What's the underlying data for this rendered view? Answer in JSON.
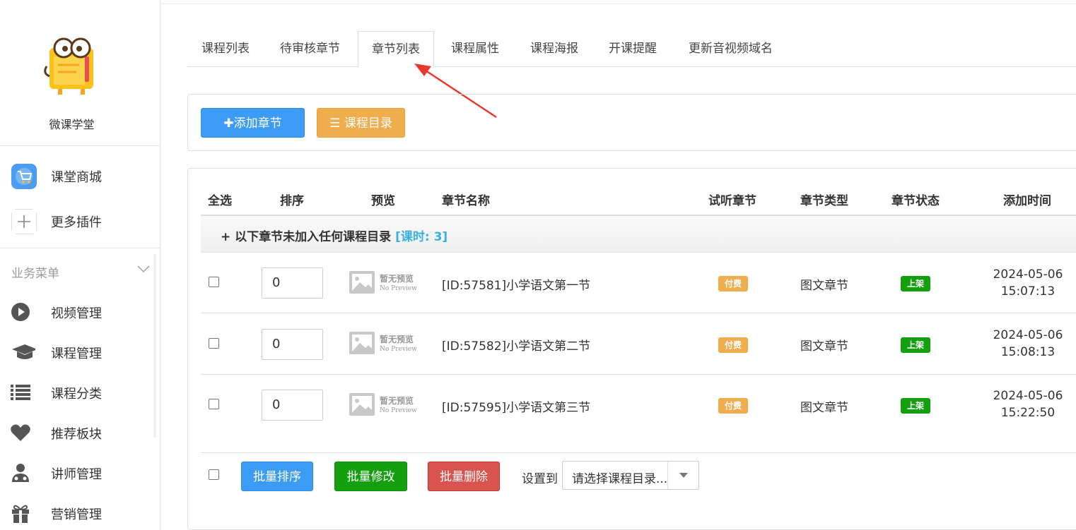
{
  "sidebar": {
    "brand_name": "微课学堂",
    "plugins": [
      {
        "label": "课堂商城",
        "icon": "cart-icon"
      },
      {
        "label": "更多插件",
        "icon": "plus-icon"
      }
    ],
    "menu_header": "业务菜单",
    "menu_items": [
      {
        "label": "视频管理",
        "icon": "play-icon"
      },
      {
        "label": "课程管理",
        "icon": "graduation-cap-icon"
      },
      {
        "label": "课程分类",
        "icon": "list-icon"
      },
      {
        "label": "推荐板块",
        "icon": "heart-icon"
      },
      {
        "label": "讲师管理",
        "icon": "user-md-icon"
      },
      {
        "label": "营销管理",
        "icon": "gift-icon"
      }
    ]
  },
  "tabs": [
    {
      "label": "课程列表",
      "active": false
    },
    {
      "label": "待审核章节",
      "active": false
    },
    {
      "label": "章节列表",
      "active": true
    },
    {
      "label": "课程属性",
      "active": false
    },
    {
      "label": "课程海报",
      "active": false
    },
    {
      "label": "开课提醒",
      "active": false
    },
    {
      "label": "更新音视频域名",
      "active": false
    }
  ],
  "actions": {
    "add_chapter": "添加章节",
    "course_catalog": "课程目录"
  },
  "table": {
    "headers": {
      "select_all": "全选",
      "sort": "排序",
      "preview": "预览",
      "name": "章节名称",
      "trial": "试听章节",
      "type": "章节类型",
      "status": "章节状态",
      "added": "添加时间"
    },
    "group": {
      "prefix": "+ 以下章节未加入任何课程目录",
      "hours": "[课时: 3]"
    },
    "preview_text": {
      "main": "暂无预览",
      "sub": "No Preview"
    },
    "rows": [
      {
        "sort": "0",
        "name": "[ID:57581]小学语文第一节",
        "trial": "付费",
        "type": "图文章节",
        "status": "上架",
        "date": "2024-05-06",
        "time": "15:07:13"
      },
      {
        "sort": "0",
        "name": "[ID:57582]小学语文第二节",
        "trial": "付费",
        "type": "图文章节",
        "status": "上架",
        "date": "2024-05-06",
        "time": "15:08:13"
      },
      {
        "sort": "0",
        "name": "[ID:57595]小学语文第三节",
        "trial": "付费",
        "type": "图文章节",
        "status": "上架",
        "date": "2024-05-06",
        "time": "15:22:50"
      }
    ]
  },
  "bulk": {
    "sort": "批量排序",
    "edit": "批量修改",
    "delete": "批量删除",
    "set_to": "设置到",
    "select_placeholder": "请选择课程目录..."
  },
  "colors": {
    "primary": "#3c9cf5",
    "warning": "#f0ad4e",
    "success": "#14a00e",
    "danger": "#d9534f",
    "annotation_arrow": "#e8392f"
  }
}
